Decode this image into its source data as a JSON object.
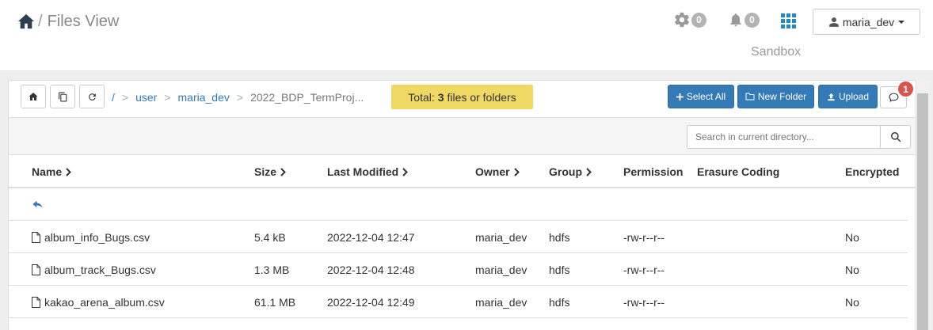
{
  "header": {
    "title": "Files View",
    "separator": "/",
    "gear_count": "0",
    "bell_count": "0",
    "user_label": "maria_dev",
    "cluster_label": "Sandbox"
  },
  "breadcrumb": {
    "root": "/",
    "sep": ">",
    "items": [
      "user",
      "maria_dev",
      "2022_BDP_TermProj..."
    ]
  },
  "total": {
    "prefix": "Total:",
    "count": "3",
    "suffix": "files or folders"
  },
  "actions": {
    "select_all": "Select All",
    "new_folder": "New Folder",
    "upload": "Upload",
    "notification_count": "1"
  },
  "search": {
    "placeholder": "Search in current directory..."
  },
  "table": {
    "columns": [
      "Name",
      "Size",
      "Last Modified",
      "Owner",
      "Group",
      "Permission",
      "Erasure Coding",
      "Encrypted"
    ],
    "rows": [
      {
        "name": "album_info_Bugs.csv",
        "size": "5.4 kB",
        "modified": "2022-12-04 12:47",
        "owner": "maria_dev",
        "group": "hdfs",
        "permission": "-rw-r--r--",
        "erasure": "",
        "encrypted": "No"
      },
      {
        "name": "album_track_Bugs.csv",
        "size": "1.3 MB",
        "modified": "2022-12-04 12:48",
        "owner": "maria_dev",
        "group": "hdfs",
        "permission": "-rw-r--r--",
        "erasure": "",
        "encrypted": "No"
      },
      {
        "name": "kakao_arena_album.csv",
        "size": "61.1 MB",
        "modified": "2022-12-04 12:49",
        "owner": "maria_dev",
        "group": "hdfs",
        "permission": "-rw-r--r--",
        "erasure": "",
        "encrypted": "No"
      }
    ]
  },
  "colors": {
    "primary": "#337ab7",
    "total_bg": "#f0d864",
    "badge_red": "#d9534f",
    "badge_gray": "#b3b3b3"
  }
}
